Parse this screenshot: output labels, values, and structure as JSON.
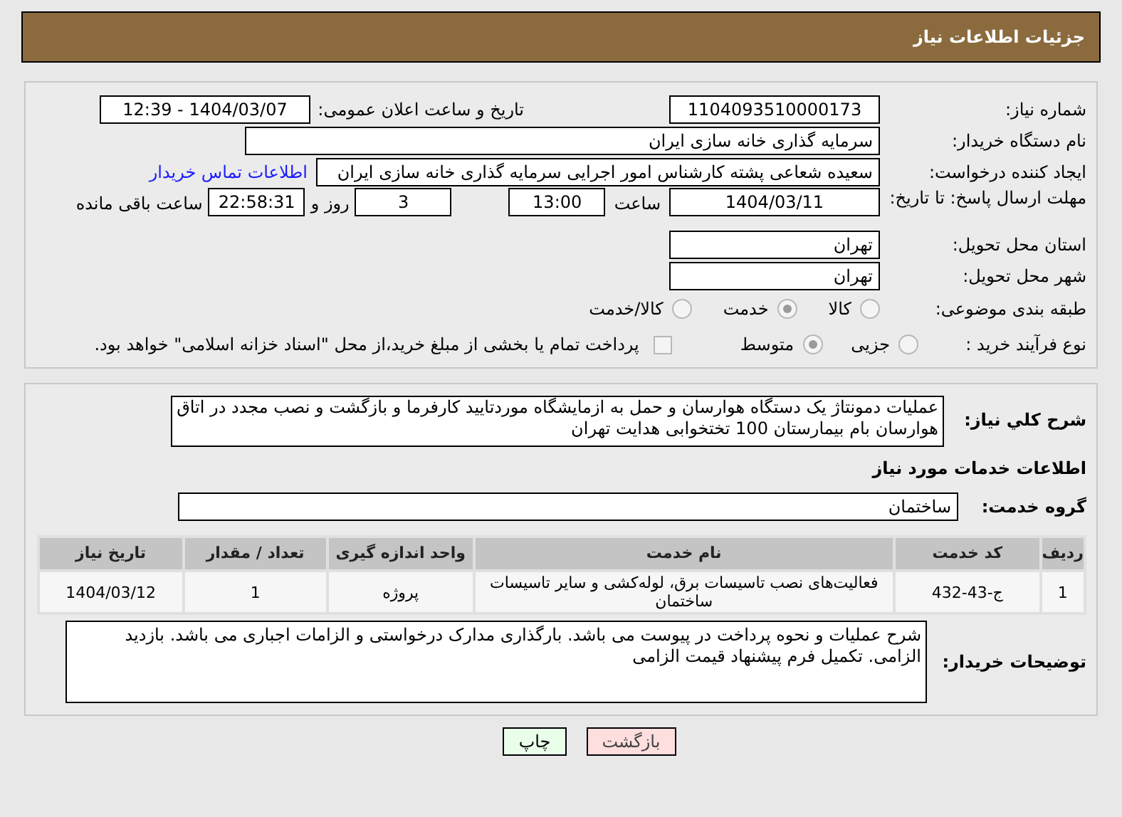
{
  "header": {
    "title": "جزئیات اطلاعات نیاز"
  },
  "need_number": {
    "label": "شماره نیاز:",
    "value": "1104093510000173"
  },
  "announce": {
    "label": "تاریخ و ساعت اعلان عمومی:",
    "value": "1404/03/07 - 12:39"
  },
  "buyer_org": {
    "label": "نام دستگاه خریدار:",
    "value": "سرمایه گذاری خانه سازی ایران"
  },
  "requester": {
    "label": "ایجاد کننده درخواست:",
    "value": "سعیده شعاعی پشته کارشناس امور اجرایی سرمایه گذاری خانه سازی ایران",
    "link": "اطلاعات تماس خریدار"
  },
  "deadline": {
    "label": "مهلت ارسال پاسخ: تا تاریخ:",
    "date": "1404/03/11",
    "time_label": "ساعت",
    "time": "13:00",
    "days": "3",
    "days_label": "روز و",
    "remaining": "22:58:31",
    "remaining_label": "ساعت باقی مانده"
  },
  "province": {
    "label": "استان محل تحویل:",
    "value": "تهران"
  },
  "city": {
    "label": "شهر محل تحویل:",
    "value": "تهران"
  },
  "category": {
    "label": "طبقه بندی موضوعی:",
    "options": [
      {
        "label": "کالا",
        "selected": false
      },
      {
        "label": "خدمت",
        "selected": true
      },
      {
        "label": "کالا/خدمت",
        "selected": false
      }
    ]
  },
  "purchase_type": {
    "label": "نوع فرآیند خرید :",
    "options": [
      {
        "label": "جزیی",
        "selected": false
      },
      {
        "label": "متوسط",
        "selected": true
      }
    ],
    "payment_note": {
      "checked": false,
      "text": "پرداخت تمام یا بخشی از مبلغ خرید،از محل \"اسناد خزانه اسلامی\" خواهد بود."
    }
  },
  "description": {
    "label": "شرح کلي نياز:",
    "value": "عملیات دمونتاژ یک دستگاه هوارسان و حمل به ازمایشگاه موردتایید کارفرما و بازگشت و نصب مجدد در اتاق هوارسان بام بیمارستان 100 تختخوابی هدایت تهران"
  },
  "services_heading": "اطلاعات خدمات مورد نیاز",
  "service_group": {
    "label": "گروه خدمت:",
    "value": "ساختمان"
  },
  "table": {
    "columns": [
      "ردیف",
      "کد خدمت",
      "نام خدمت",
      "واحد اندازه گیری",
      "تعداد / مقدار",
      "تاریخ نیاز"
    ],
    "rows": [
      [
        "1",
        "ج-43-432",
        "فعالیت‌های نصب تاسیسات برق، لوله‌کشی و سایر تاسیسات ساختمان",
        "پروژه",
        "1",
        "1404/03/12"
      ]
    ]
  },
  "buyer_notes": {
    "label": "توضیحات خریدار:",
    "value": "شرح عملیات و نحوه پرداخت در پیوست می باشد. بارگذاری مدارک درخواستی و الزامات اجباری می باشد.  بازدید الزامی. تکمیل فرم پیشنهاد قیمت الزامی"
  },
  "buttons": [
    {
      "label": "بازگشت",
      "kind": "back"
    },
    {
      "label": "چاپ",
      "kind": "print"
    }
  ]
}
